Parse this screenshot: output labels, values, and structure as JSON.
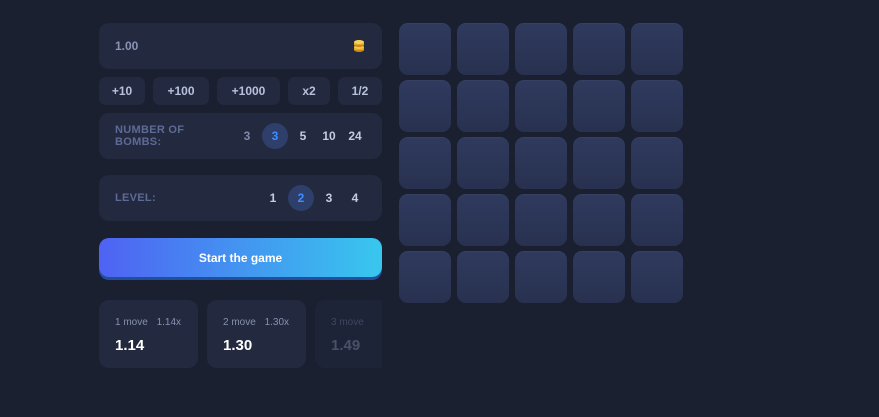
{
  "bet": {
    "value": "1.00",
    "icon": "coins-icon"
  },
  "quick_buttons": [
    "+10",
    "+100",
    "+1000",
    "x2",
    "1/2"
  ],
  "bombs": {
    "label_line1": "NUMBER OF",
    "label_line2": "BOMBS:",
    "options": [
      "3",
      "3",
      "5",
      "10",
      "24"
    ],
    "selected": "3"
  },
  "level": {
    "label": "LEVEL:",
    "options": [
      "1",
      "2",
      "3",
      "4"
    ],
    "selected": "2"
  },
  "start_button": "Start the game",
  "history": [
    {
      "moves": "1 move",
      "multiplier": "1.14x",
      "value": "1.14"
    },
    {
      "moves": "2 move",
      "multiplier": "1.30x",
      "value": "1.30"
    },
    {
      "moves": "3 move",
      "multiplier": "",
      "value": "1.49"
    }
  ],
  "grid": {
    "rows": 5,
    "cols": 5
  },
  "colors": {
    "background": "#1b2030",
    "panel": "#232a3f",
    "accent": "#3f8cff",
    "button_gradient_start": "#4f62f3",
    "button_gradient_end": "#38c7ee",
    "tile": "#2c3658"
  }
}
